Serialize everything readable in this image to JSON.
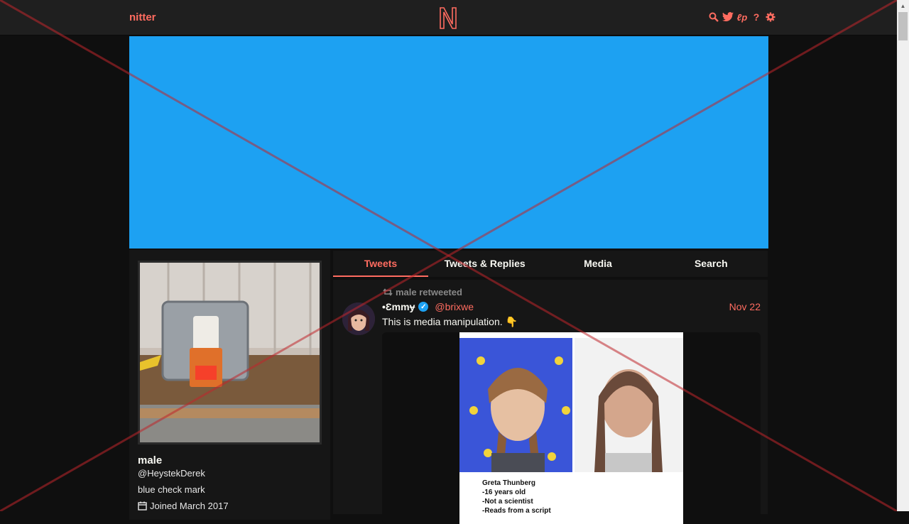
{
  "navbar": {
    "brand": "nitter"
  },
  "profile": {
    "name": "male",
    "handle": "@HeystekDerek",
    "bio": "blue check mark",
    "joined": "Joined March 2017"
  },
  "tabs": [
    {
      "label": "Tweets",
      "active": true
    },
    {
      "label": "Tweets & Replies",
      "active": false
    },
    {
      "label": "Media",
      "active": false
    },
    {
      "label": "Search",
      "active": false
    }
  ],
  "tweet": {
    "retweet_by": "male retweeted",
    "author_name": "•Ɛmmɏ",
    "author_handle": "@brixwe",
    "date": "Nov 22",
    "text": "This is media manipulation. 👇"
  },
  "media_caption": {
    "line1": "Greta Thunberg",
    "line2": "-16 years old",
    "line3": "-Not a scientist",
    "line4": "-Reads from a script"
  },
  "colors": {
    "accent": "#ff6c60",
    "banner": "#1da1f2",
    "background": "#0f0f0f",
    "panel": "#161616"
  }
}
